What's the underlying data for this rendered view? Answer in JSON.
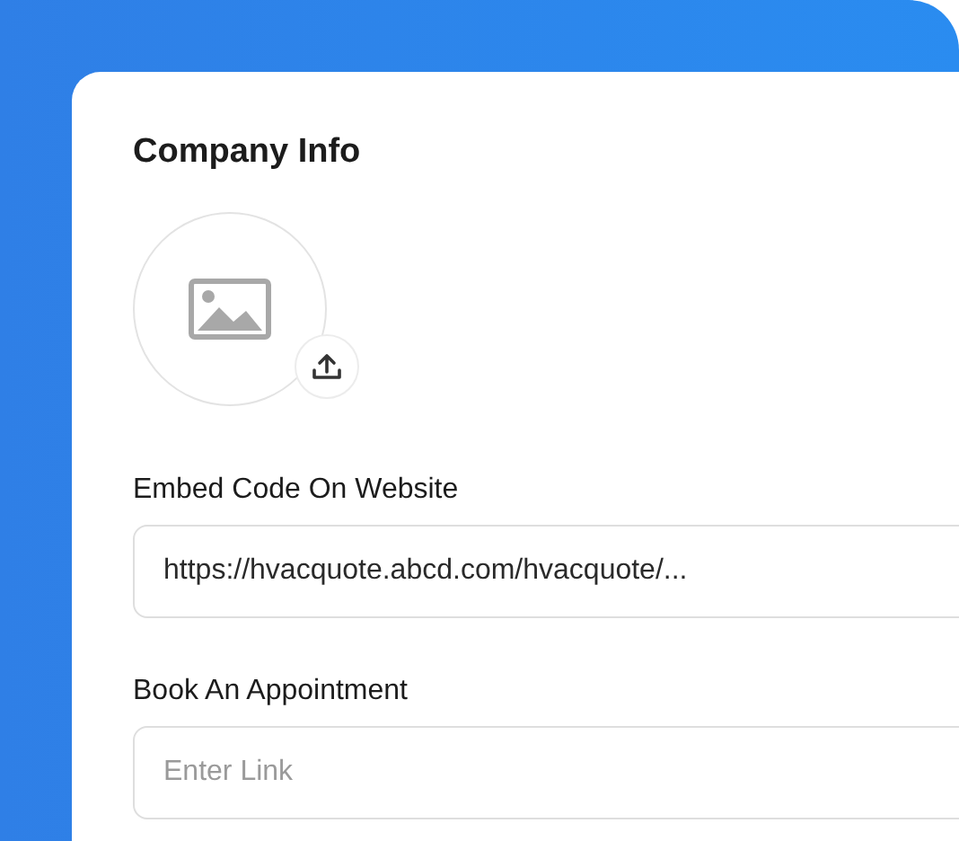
{
  "card": {
    "title": "Company Info"
  },
  "fields": [
    {
      "label": "Embed Code On Website",
      "value": "https://hvacquote.abcd.com/hvacquote/..."
    },
    {
      "label": "Book An Appointment",
      "placeholder": "Enter Link"
    }
  ]
}
